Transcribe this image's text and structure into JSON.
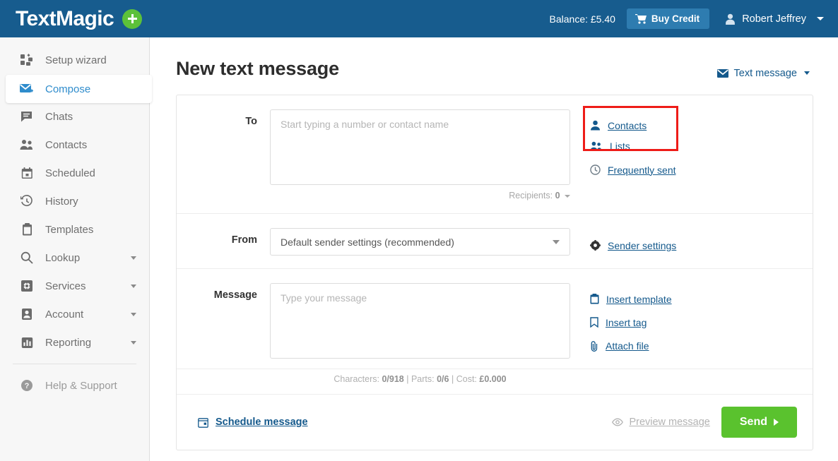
{
  "header": {
    "brand": "TextMagic",
    "add_button_icon": "plus-icon",
    "balance": "Balance: £5.40",
    "buy_credit_label": "Buy Credit",
    "buy_credit_icon": "cart-icon",
    "user_name": "Robert Jeffrey",
    "user_icon": "user-icon",
    "background_color": "#175c8e",
    "buy_credit_color": "#2e7cb0"
  },
  "sidebar": {
    "items": [
      {
        "label": "Setup wizard",
        "icon": "grid-blocks-icon",
        "active": false,
        "expandable": false
      },
      {
        "label": "Compose",
        "icon": "compose-envelope-icon",
        "active": true,
        "expandable": false
      },
      {
        "label": "Chats",
        "icon": "chat-bubble-icon",
        "active": false,
        "expandable": false
      },
      {
        "label": "Contacts",
        "icon": "contacts-people-icon",
        "active": false,
        "expandable": false
      },
      {
        "label": "Scheduled",
        "icon": "calendar-icon",
        "active": false,
        "expandable": false
      },
      {
        "label": "History",
        "icon": "clock-history-icon",
        "active": false,
        "expandable": false
      },
      {
        "label": "Templates",
        "icon": "clipboard-icon",
        "active": false,
        "expandable": false
      },
      {
        "label": "Lookup",
        "icon": "search-icon",
        "active": false,
        "expandable": true
      },
      {
        "label": "Services",
        "icon": "gear-icon",
        "active": false,
        "expandable": true
      },
      {
        "label": "Account",
        "icon": "account-person-icon",
        "active": false,
        "expandable": true
      },
      {
        "label": "Reporting",
        "icon": "bar-chart-icon",
        "active": false,
        "expandable": true
      }
    ],
    "help": {
      "label": "Help & Support",
      "icon": "question-circle-icon"
    },
    "active_color": "#2f8ccc",
    "background_color": "#f7f7f7"
  },
  "main": {
    "page_title": "New text message",
    "message_type": {
      "label": "Text message",
      "icon": "envelope-icon"
    },
    "to": {
      "label": "To",
      "placeholder": "Start typing a number or contact name",
      "value": "",
      "recipients_text": "Recipients:",
      "recipients_count": "0",
      "actions": [
        {
          "label": "Contacts",
          "icon": "person-icon",
          "highlighted": true
        },
        {
          "label": "Lists",
          "icon": "people-icon",
          "highlighted": true
        },
        {
          "label": "Frequently sent",
          "icon": "clock-icon",
          "highlighted": false
        }
      ],
      "highlight_color": "#ee1c18"
    },
    "from": {
      "label": "From",
      "selected_option": "Default sender settings (recommended)",
      "action": {
        "label": "Sender settings",
        "icon": "gear-icon"
      }
    },
    "message": {
      "label": "Message",
      "placeholder": "Type your message",
      "value": "",
      "actions": [
        {
          "label": "Insert template",
          "icon": "clipboard-icon"
        },
        {
          "label": "Insert tag",
          "icon": "bookmark-icon"
        },
        {
          "label": "Attach file",
          "icon": "paperclip-icon"
        }
      ],
      "counter": {
        "characters_label": "Characters:",
        "characters_value": "0/918",
        "parts_label": "Parts:",
        "parts_value": "0/6",
        "cost_label": "Cost:",
        "cost_value": "£0.000",
        "separator": "|"
      }
    },
    "footer": {
      "schedule": {
        "label": "Schedule message",
        "icon": "calendar-icon"
      },
      "preview": {
        "label": "Preview message",
        "icon": "eye-icon",
        "disabled": true
      },
      "send": {
        "label": "Send",
        "icon": "arrow-right-icon",
        "color": "#5ac22e"
      }
    }
  }
}
